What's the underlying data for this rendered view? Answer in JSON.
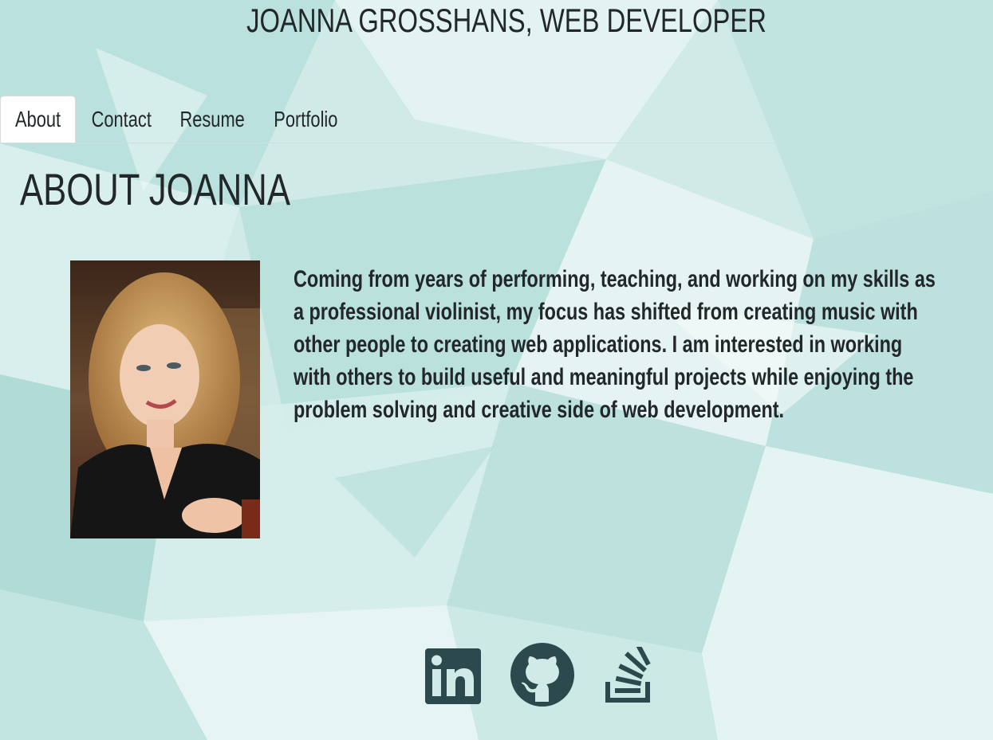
{
  "header": {
    "title": "JOANNA GROSSHANS, WEB DEVELOPER"
  },
  "nav": {
    "tabs": [
      {
        "label": "About",
        "active": true
      },
      {
        "label": "Contact",
        "active": false
      },
      {
        "label": "Resume",
        "active": false
      },
      {
        "label": "Portfolio",
        "active": false
      }
    ]
  },
  "about": {
    "heading": "ABOUT JOANNA",
    "bio": "Coming from years of performing, teaching, and working on my skills as a professional violinist, my focus has shifted from creating music with other people to creating web applications. I am interested in working with others to build useful and meaningful projects while enjoying the problem solving and creative side of web development."
  },
  "social": {
    "icons": [
      "linkedin-icon",
      "github-icon",
      "stackoverflow-icon"
    ],
    "icon_color": "#2c4a4d"
  },
  "colors": {
    "background": "#c9e9e6",
    "text": "#22272a",
    "active_tab": "#ffffff"
  }
}
